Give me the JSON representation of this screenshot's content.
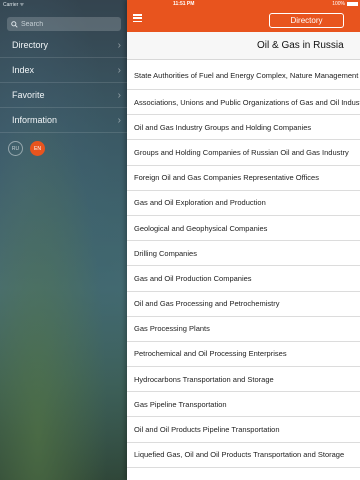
{
  "status": {
    "carrier": "Carrier ᯤ",
    "time": "11:51 PM",
    "battery": "100%"
  },
  "sidebar": {
    "search_placeholder": "Search",
    "items": [
      {
        "label": "Directory"
      },
      {
        "label": "Index"
      },
      {
        "label": "Favorite"
      },
      {
        "label": "Information"
      }
    ],
    "languages": [
      "RU",
      "EN"
    ],
    "active_language": "EN"
  },
  "header": {
    "directory_button": "Directory",
    "title": "Oil & Gas in Russia"
  },
  "list": [
    "State Authorities of Fuel and Energy Complex, Nature Management and Ecology",
    "Associations, Unions and Public Organizations of Gas and Oil Industry",
    "Oil and Gas Industry Groups and Holding Companies",
    "Groups and Holding Companies of Russian Oil and Gas Industry",
    "Foreign Oil and Gas Companies Representative Offices",
    "Gas and Oil Exploration and Production",
    "Geological and Geophysical Companies",
    "Drilling Companies",
    "Gas and Oil Production Companies",
    "Oil and Gas Processing and Petrochemistry",
    "Gas Processing Plants",
    "Petrochemical and Oil Processing Enterprises",
    "Hydrocarbons Transportation and Storage",
    "Gas Pipeline Transportation",
    "Oil and Oil Products Pipeline Transportation",
    "Liquefied Gas, Oil and Oil Products Transportation and Storage"
  ],
  "colors": {
    "accent": "#e8541e"
  }
}
